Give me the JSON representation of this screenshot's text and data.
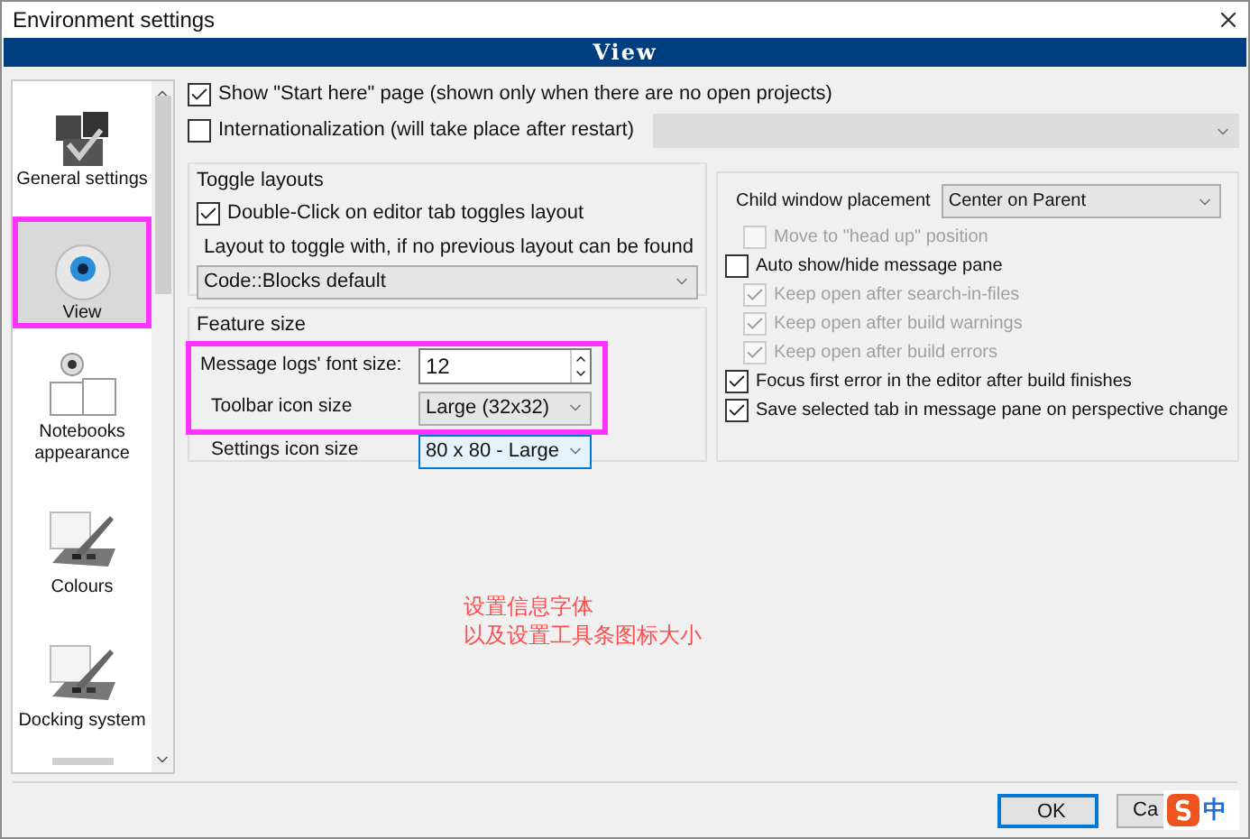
{
  "window": {
    "title": "Environment settings"
  },
  "header": {
    "title": "View"
  },
  "sidebar": {
    "items": [
      {
        "label": "General settings",
        "kind": "cubes",
        "selected": false
      },
      {
        "label": "View",
        "kind": "eye",
        "selected": true,
        "highlighted": true
      },
      {
        "label": "Notebooks appearance",
        "kind": "webcam",
        "selected": false
      },
      {
        "label": "Colours",
        "kind": "palette",
        "selected": false
      },
      {
        "label": "Docking system",
        "kind": "palette",
        "selected": false
      }
    ]
  },
  "start_here": {
    "label": "Show \"Start here\" page (shown only when there are no open projects)",
    "checked": true
  },
  "internationalization": {
    "label": "Internationalization (will take place after restart)",
    "checked": false,
    "language_dropdown": {
      "disabled": true
    }
  },
  "toggle_layouts": {
    "title": "Toggle layouts",
    "double_click": {
      "label": "Double-Click on editor tab toggles layout",
      "checked": true
    },
    "layout_label": "Layout to toggle with, if no previous layout can be found",
    "layout_select": {
      "value": "Code::Blocks default"
    }
  },
  "feature_size": {
    "title": "Feature size",
    "rows": [
      {
        "label": "Message logs' font size:",
        "kind": "spin",
        "value": "12",
        "highlighted": true,
        "focused": false
      },
      {
        "label": "Toolbar icon size",
        "kind": "select",
        "value": "Large (32x32)",
        "highlighted": true,
        "focused": false
      },
      {
        "label": "Settings icon size",
        "kind": "select",
        "value": "80 x 80 - Large",
        "highlighted": false,
        "focused": true
      }
    ]
  },
  "child_window_placement": {
    "label": "Child window placement",
    "value": "Center on Parent",
    "children": [
      {
        "label": "Move to \"head up\" position",
        "checked": false,
        "disabled": true
      }
    ]
  },
  "message_pane": [
    {
      "label": "Auto show/hide message pane",
      "checked": false,
      "disabled": false,
      "children": [
        {
          "label": "Keep open after search-in-files",
          "checked": true,
          "disabled": true
        },
        {
          "label": "Keep open after build warnings",
          "checked": true,
          "disabled": true
        },
        {
          "label": "Keep open after build errors",
          "checked": true,
          "disabled": true
        }
      ]
    },
    {
      "label": "Focus first error in the editor after build finishes",
      "checked": true,
      "disabled": false
    },
    {
      "label": "Save selected tab in message pane on perspective change",
      "checked": true,
      "disabled": false
    }
  ],
  "annotation": {
    "lines": [
      "设置信息字体",
      "以及设置工具条图标大小"
    ]
  },
  "buttons": [
    {
      "label": "OK",
      "default": true
    },
    {
      "label": "Ca",
      "default": false
    }
  ],
  "ime_indicator": {
    "label": "中"
  }
}
